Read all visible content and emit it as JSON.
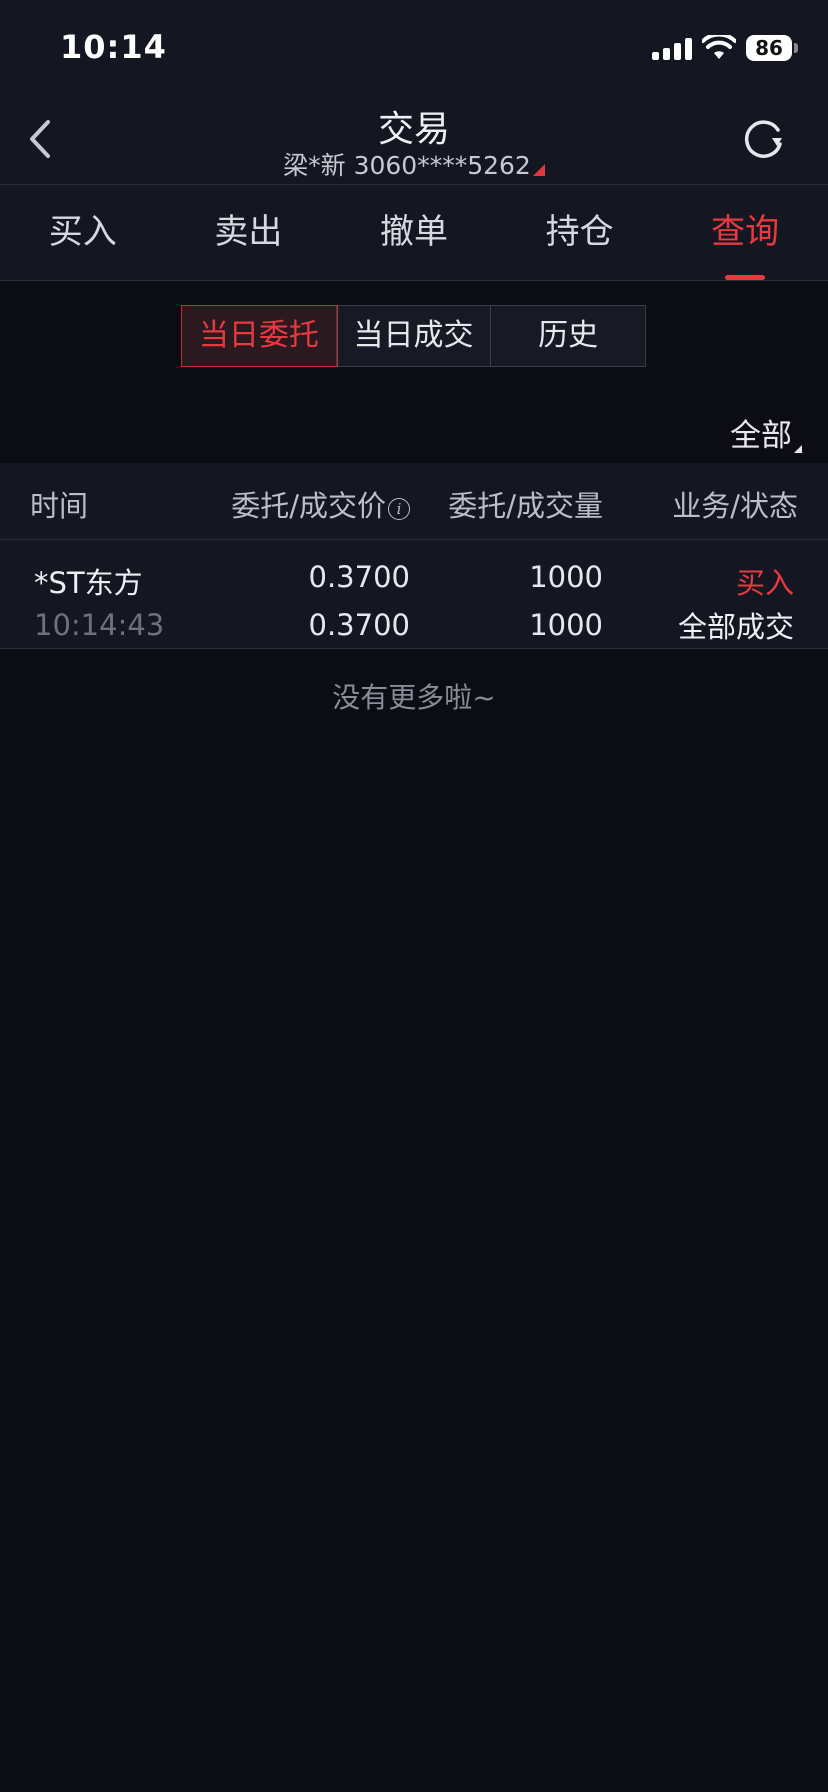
{
  "status_bar": {
    "time": "10:14",
    "battery": "86"
  },
  "nav": {
    "title": "交易",
    "account": "梁*新 3060****5262"
  },
  "tabs": [
    {
      "label": "买入"
    },
    {
      "label": "卖出"
    },
    {
      "label": "撤单"
    },
    {
      "label": "持仓"
    },
    {
      "label": "查询",
      "active": true
    }
  ],
  "segments": [
    {
      "label": "当日委托",
      "active": true
    },
    {
      "label": "当日成交"
    },
    {
      "label": "历史"
    }
  ],
  "filter": {
    "label": "全部"
  },
  "table": {
    "headers": {
      "time": "时间",
      "price": "委托/成交价",
      "quantity": "委托/成交量",
      "status": "业务/状态"
    },
    "rows": [
      {
        "name": "*ST东方",
        "time": "10:14:43",
        "order_price": "0.3700",
        "deal_price": "0.3700",
        "order_qty": "1000",
        "deal_qty": "1000",
        "business": "买入",
        "state": "全部成交"
      }
    ]
  },
  "footer": {
    "no_more": "没有更多啦~"
  },
  "colors": {
    "accent": "#e8393f",
    "background": "#0b0c14",
    "panel": "#141722"
  }
}
